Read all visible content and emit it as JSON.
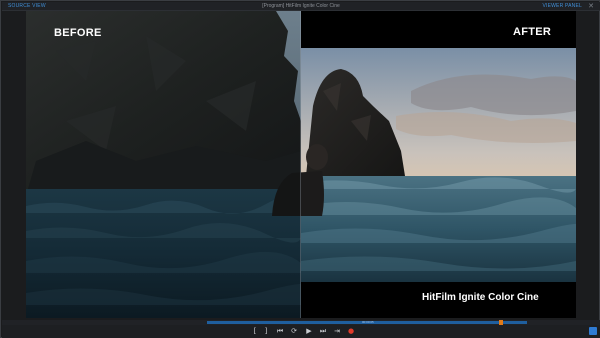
{
  "window": {
    "left_label": "SOURCE VIEW",
    "title": "[Program] HitFilm Ignite Color Cine",
    "right_label": "VIEWER PANEL"
  },
  "viewer": {
    "label_before": "BEFORE",
    "label_after": "AFTER",
    "caption": "HitFilm Ignite Color Cine"
  },
  "timeline": {
    "scrub_label": "00:00:05",
    "playhead_fraction": 0.92
  },
  "controls": [
    {
      "name": "in-point",
      "glyph": "["
    },
    {
      "name": "out-point",
      "glyph": "]"
    },
    {
      "name": "prev-frame",
      "glyph": "⏮"
    },
    {
      "name": "loop",
      "glyph": "⟳"
    },
    {
      "name": "play",
      "glyph": "▶"
    },
    {
      "name": "next-frame",
      "glyph": "⏭"
    },
    {
      "name": "to-end",
      "glyph": "⇥"
    },
    {
      "name": "record",
      "glyph": "●"
    }
  ],
  "colors": {
    "accent": "#3f8ed6",
    "scrub_track": "#1f5f9e",
    "playhead": "#e07a18",
    "record": "#e03a2a"
  }
}
